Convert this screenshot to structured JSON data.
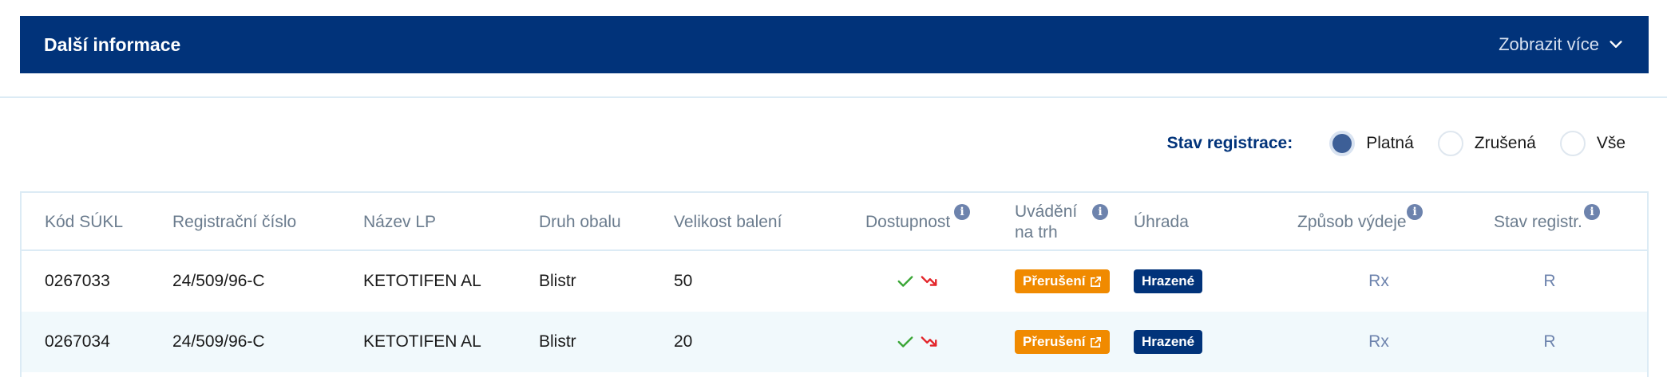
{
  "info_bar": {
    "title": "Další informace",
    "show_more": "Zobrazit více"
  },
  "filter": {
    "label": "Stav registrace:",
    "options": [
      {
        "label": "Platná",
        "checked": true
      },
      {
        "label": "Zrušená",
        "checked": false
      },
      {
        "label": "Vše",
        "checked": false
      }
    ]
  },
  "table": {
    "headers": {
      "kod": "Kód SÚKL",
      "reg": "Registrační číslo",
      "nazev": "Název LP",
      "druh": "Druh obalu",
      "velikost": "Velikost balení",
      "dostupnost": "Dostupnost",
      "uvadeni_1": "Uvádění",
      "uvadeni_2": "na trh",
      "uhrada": "Úhrada",
      "zpusob": "Způsob výdeje",
      "stav": "Stav registr."
    },
    "rows": [
      {
        "kod": "0267033",
        "reg": "24/509/96-C",
        "nazev": "KETOTIFEN AL",
        "druh": "Blistr",
        "velikost": "50",
        "uvadeni": "Přerušení",
        "uhrada": "Hrazené",
        "zpusob": "Rx",
        "stav": "R"
      },
      {
        "kod": "0267034",
        "reg": "24/509/96-C",
        "nazev": "KETOTIFEN AL",
        "druh": "Blistr",
        "velikost": "20",
        "uvadeni": "Přerušení",
        "uhrada": "Hrazené",
        "zpusob": "Rx",
        "stav": "R"
      }
    ]
  },
  "colors": {
    "navy": "#01337a",
    "orange": "#f08a00",
    "check_green": "#3aa636",
    "trend_red": "#e3262b",
    "link": "#6d83ad"
  },
  "icons": {
    "expand": "chevron-down-icon",
    "info": "info-icon",
    "available": "check-icon",
    "decline": "trend-down-icon",
    "external": "external-link-icon"
  }
}
